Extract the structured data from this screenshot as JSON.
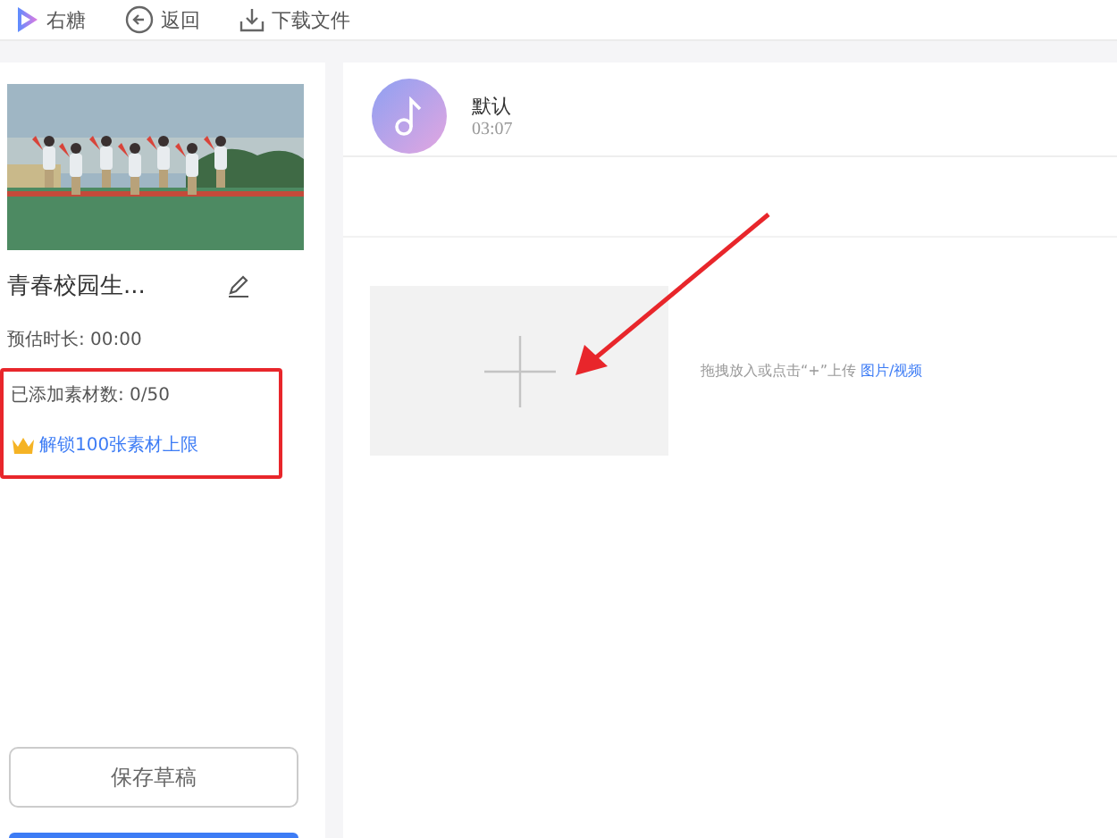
{
  "toolbar": [
    {
      "kind": "logo",
      "label": "右糖"
    },
    {
      "kind": "back",
      "label": "返回"
    },
    {
      "kind": "download",
      "label": "下载文件"
    }
  ],
  "project": {
    "title": "青春校园生...",
    "duration": "预估时长: 00:00",
    "material_count": "已添加素材数: 0/50",
    "unlock_link": "解锁100张素材上限",
    "highlighted": true
  },
  "save_button": "保存草稿",
  "music": {
    "title": "默认",
    "time": "03:07"
  },
  "upload": {
    "hint": "拖拽放入或点击“+”上传",
    "link": "图片/视频",
    "arrow": true
  }
}
